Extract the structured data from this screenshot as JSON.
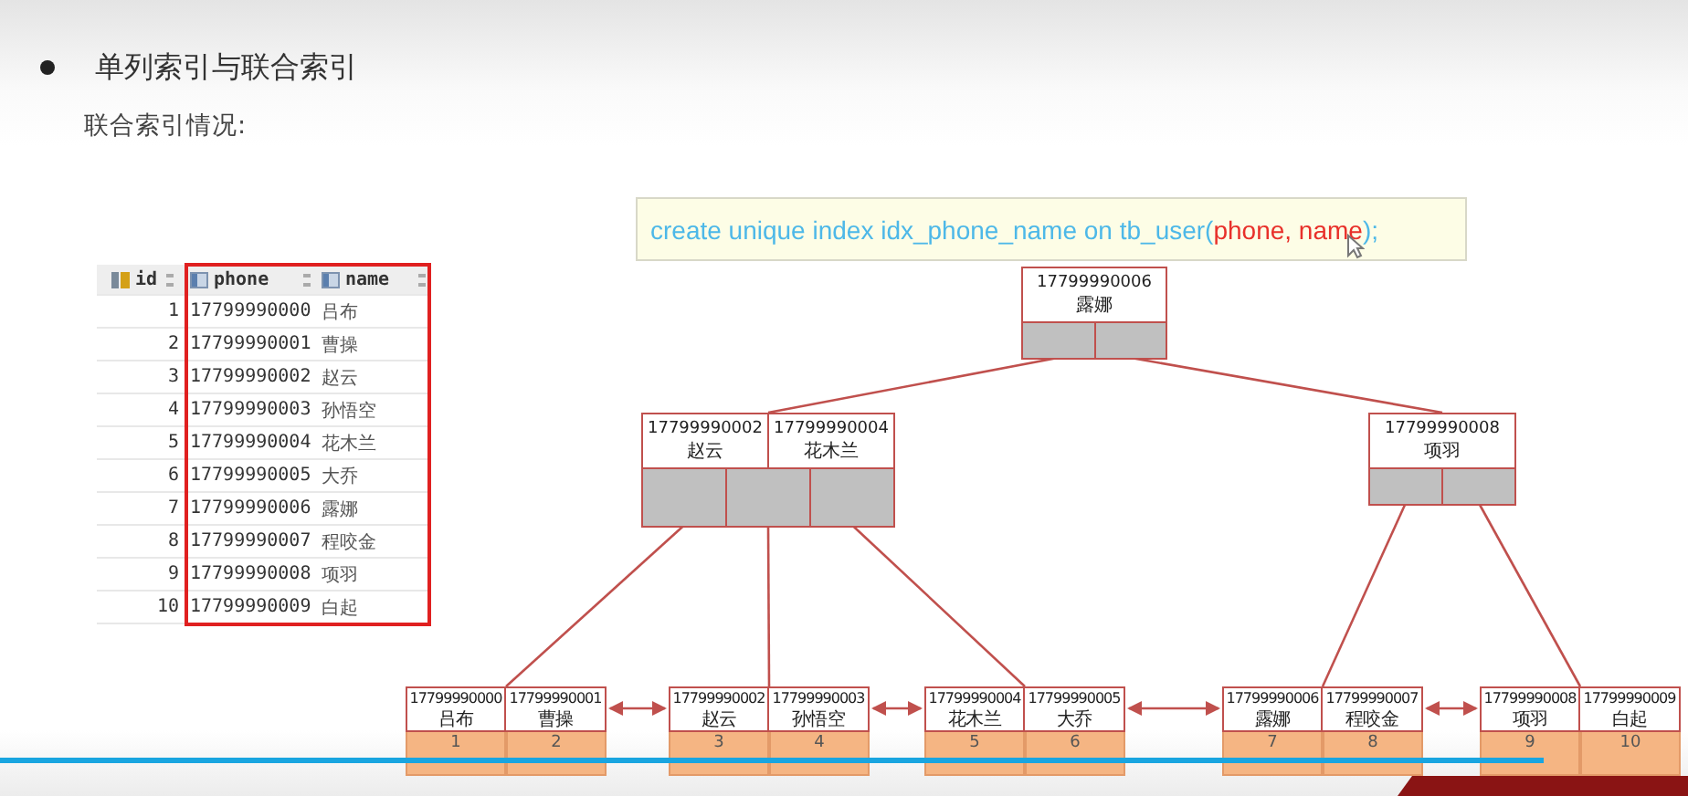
{
  "slide": {
    "heading": "单列索引与联合索引",
    "subheading": "联合索引情况:",
    "table": {
      "columns": [
        {
          "label": "id",
          "kind": "key",
          "highlighted": false
        },
        {
          "label": "phone",
          "kind": "column",
          "highlighted": true
        },
        {
          "label": "name",
          "kind": "column",
          "highlighted": true
        }
      ],
      "rows": [
        [
          "1",
          "17799990000",
          "吕布"
        ],
        [
          "2",
          "17799990001",
          "曹操"
        ],
        [
          "3",
          "17799990002",
          "赵云"
        ],
        [
          "4",
          "17799990003",
          "孙悟空"
        ],
        [
          "5",
          "17799990004",
          "花木兰"
        ],
        [
          "6",
          "17799990005",
          "大乔"
        ],
        [
          "7",
          "17799990006",
          "露娜"
        ],
        [
          "8",
          "17799990007",
          "程咬金"
        ],
        [
          "9",
          "17799990008",
          "项羽"
        ],
        [
          "10",
          "17799990009",
          "白起"
        ]
      ]
    },
    "sql": {
      "parts": [
        {
          "text": "create unique index idx_phone_name on tb_user(",
          "color": "#4db8e8"
        },
        {
          "text": "phone, name",
          "color": "#e8302a"
        },
        {
          "text": ");",
          "color": "#4db8e8"
        }
      ]
    },
    "tree": {
      "keys": [
        {
          "phone": "17799990006",
          "name": "露娜"
        }
      ],
      "children": [
        {
          "keys": [
            {
              "phone": "17799990002",
              "name": "赵云"
            },
            {
              "phone": "17799990004",
              "name": "花木兰"
            }
          ],
          "children": [
            {
              "keys": [
                {
                  "phone": "17799990000",
                  "name": "吕布",
                  "row": "1"
                },
                {
                  "phone": "17799990001",
                  "name": "曹操",
                  "row": "2"
                }
              ]
            },
            {
              "keys": [
                {
                  "phone": "17799990002",
                  "name": "赵云",
                  "row": "3"
                },
                {
                  "phone": "17799990003",
                  "name": "孙悟空",
                  "row": "4"
                }
              ]
            },
            {
              "keys": [
                {
                  "phone": "17799990004",
                  "name": "花木兰",
                  "row": "5"
                },
                {
                  "phone": "17799990005",
                  "name": "大乔",
                  "row": "6"
                }
              ]
            }
          ]
        },
        {
          "keys": [
            {
              "phone": "17799990008",
              "name": "项羽"
            }
          ],
          "children": [
            {
              "keys": [
                {
                  "phone": "17799990006",
                  "name": "露娜",
                  "row": "7"
                },
                {
                  "phone": "17799990007",
                  "name": "程咬金",
                  "row": "8"
                }
              ]
            },
            {
              "keys": [
                {
                  "phone": "17799990008",
                  "name": "项羽",
                  "row": "9"
                },
                {
                  "phone": "17799990009",
                  "name": "白起",
                  "row": "10"
                }
              ]
            }
          ]
        }
      ]
    }
  },
  "player": {
    "progress": {
      "level": 0.915
    }
  }
}
